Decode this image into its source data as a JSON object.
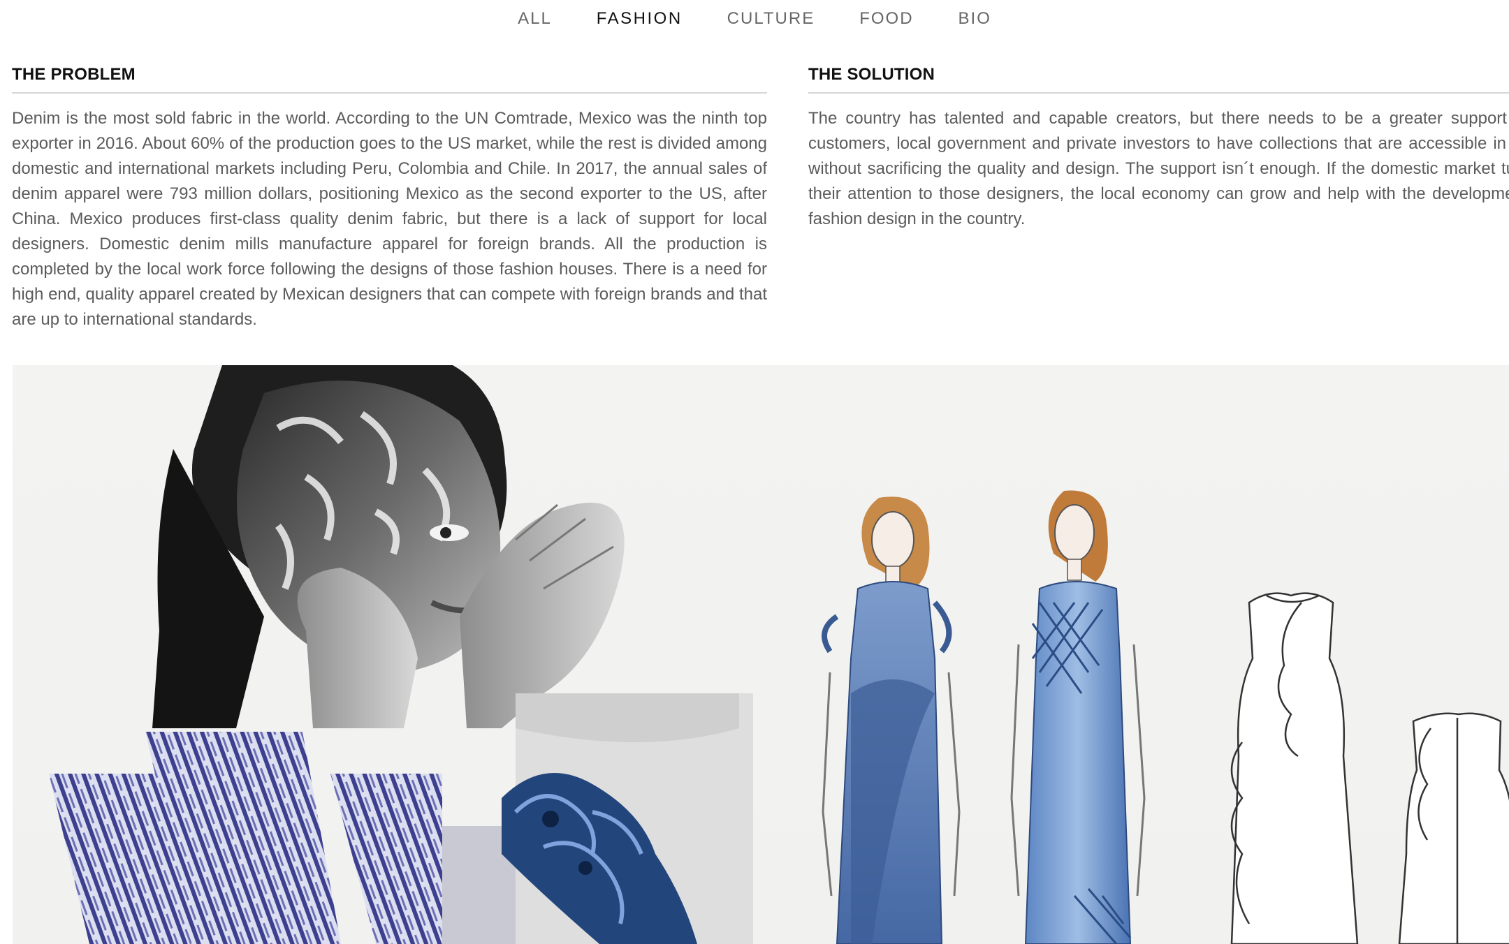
{
  "nav": {
    "items": [
      {
        "label": "ALL",
        "active": false
      },
      {
        "label": "FASHION",
        "active": true
      },
      {
        "label": "CULTURE",
        "active": false
      },
      {
        "label": "FOOD",
        "active": false
      },
      {
        "label": "BIO",
        "active": false
      }
    ]
  },
  "problem": {
    "heading": "THE PROBLEM",
    "body": "Denim is the most sold fabric in the world. According to the UN Comtrade, Mexico was the ninth top exporter in 2016. About 60% of the production goes to the US market, while the rest is divided among domestic and international markets including Peru, Colombia and Chile. In 2017, the annual sales of denim apparel were 793 million dollars, positioning Mexico as the second exporter to the US, after China. Mexico produces first-class quality denim fabric, but there is a lack of support for local designers. Domestic denim mills manufacture apparel for foreign brands. All the production is completed by the local work force following the designs of those fashion houses. There is a need for high end, quality apparel created by Mexican designers that can compete with foreign brands and that are up to international standards."
  },
  "solution": {
    "heading": "THE SOLUTION",
    "body": "The country has talented and capable creators, but there needs to be a greater support from customers, local government and private investors to have collections that are accessible in price without sacrificing the quality and design. The support isn´t enough. If the domestic market turned their attention to those designers, the local economy can grow and help with the development of fashion design in the country."
  },
  "colors": {
    "nav_active": "#111111",
    "nav_inactive": "#666666",
    "denim": "#4a6fa8",
    "background": "#f2f2f0"
  }
}
